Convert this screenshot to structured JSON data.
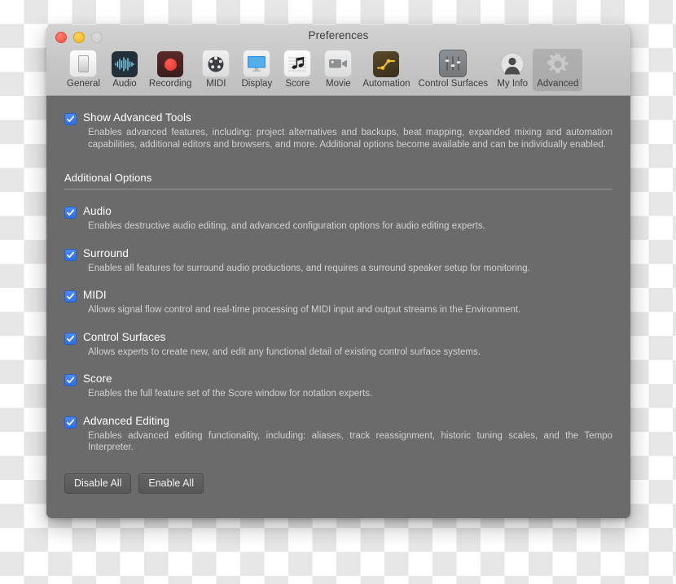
{
  "window": {
    "title": "Preferences",
    "traffic_lights": [
      "close-button",
      "minimize-button",
      "zoom-button"
    ]
  },
  "toolbar": {
    "items": [
      {
        "label": "General",
        "icon": "slider-switch-icon",
        "selected": false
      },
      {
        "label": "Audio",
        "icon": "waveform-icon",
        "selected": false
      },
      {
        "label": "Recording",
        "icon": "record-dot-icon",
        "selected": false
      },
      {
        "label": "MIDI",
        "icon": "midi-connector-icon",
        "selected": false
      },
      {
        "label": "Display",
        "icon": "monitor-icon",
        "selected": false
      },
      {
        "label": "Score",
        "icon": "music-note-icon",
        "selected": false
      },
      {
        "label": "Movie",
        "icon": "video-camera-icon",
        "selected": false
      },
      {
        "label": "Automation",
        "icon": "automation-curve-icon",
        "selected": false
      },
      {
        "label": "Control Surfaces",
        "icon": "faders-icon",
        "selected": false
      },
      {
        "label": "My Info",
        "icon": "person-avatar-icon",
        "selected": false
      },
      {
        "label": "Advanced",
        "icon": "gear-icon",
        "selected": true
      }
    ]
  },
  "main": {
    "primary": {
      "label": "Show Advanced Tools",
      "checked": true,
      "description": "Enables advanced features, including: project alternatives and backups, beat mapping, expanded mixing and automation capabilities, additional editors and browsers, and more. Additional options become available and can be individually enabled."
    },
    "section_header": "Additional Options",
    "options": [
      {
        "label": "Audio",
        "checked": true,
        "description": "Enables destructive audio editing, and advanced configuration options for audio editing experts."
      },
      {
        "label": "Surround",
        "checked": true,
        "description": "Enables all features for surround audio productions, and requires a surround speaker setup for monitoring."
      },
      {
        "label": "MIDI",
        "checked": true,
        "description": "Allows signal flow control and real-time processing of MIDI input and output streams in the Environment."
      },
      {
        "label": "Control Surfaces",
        "checked": true,
        "description": "Allows experts to create new, and edit any functional detail of existing control surface systems."
      },
      {
        "label": "Score",
        "checked": true,
        "description": "Enables the full feature set of the Score window for notation experts."
      },
      {
        "label": "Advanced Editing",
        "checked": true,
        "description": "Enables advanced editing functionality, including: aliases, track reassignment, historic tuning scales, and the Tempo Interpreter."
      }
    ],
    "buttons": {
      "disable_all": "Disable All",
      "enable_all": "Enable All"
    }
  },
  "colors": {
    "window_body": "#6b6b6b",
    "toolbar": "#c6c6c6",
    "checkbox_blue": "#3478f6",
    "title_text": "#3d3d3d",
    "body_text": "#ffffff",
    "desc_text": "#d2d2d2"
  }
}
